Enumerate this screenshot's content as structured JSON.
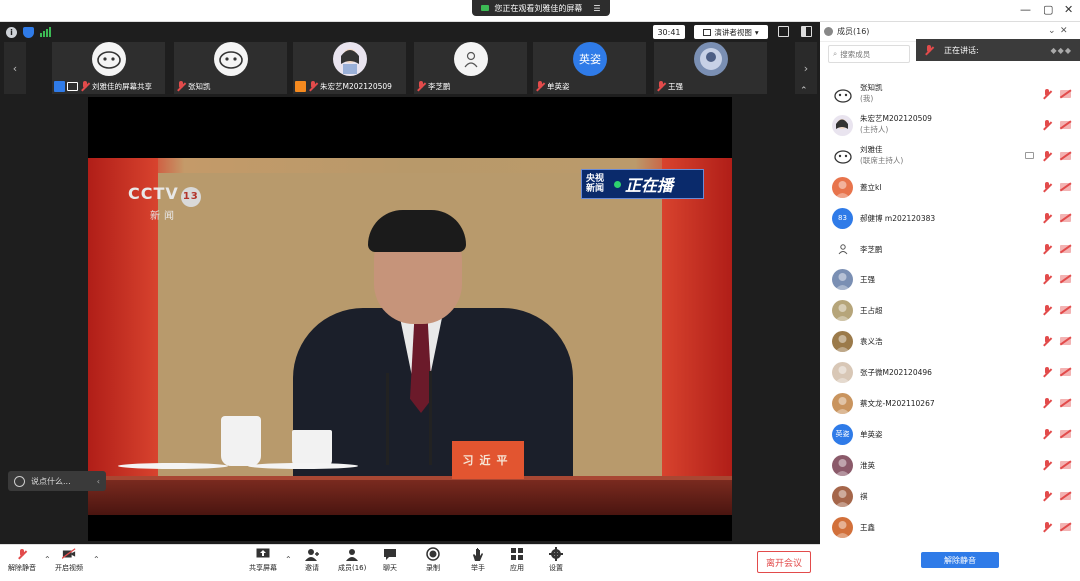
{
  "window": {
    "share_banner": "您正在观看刘雅佳的屏幕",
    "controls": [
      "—",
      "▢",
      "✕"
    ]
  },
  "meeting": {
    "timer": "30:41",
    "view_mode": "演讲者视图",
    "thumbnails": [
      {
        "name": "刘雅佳的屏幕共享"
      },
      {
        "name": "张知凯"
      },
      {
        "name": "朱宏艺M202120509"
      },
      {
        "name": "李芝鹏"
      },
      {
        "name": "单英姿",
        "avatar_text": "英姿",
        "avatar_color": "#2f7be8"
      },
      {
        "name": "王强"
      }
    ],
    "comment_placeholder": "说点什么..."
  },
  "video": {
    "channel_logo": "CCTV",
    "channel_num": "13",
    "channel_sub": "新闻",
    "live_tag_a": "央视新闻",
    "live_tag_b": "正在播",
    "nameplate": "习近平"
  },
  "toolbar": {
    "unmute": "解除静音",
    "start_video": "开启视频",
    "share_screen": "共享屏幕",
    "invite": "邀请",
    "members": "成员(16)",
    "chat": "聊天",
    "record": "录制",
    "raise_hand": "举手",
    "apps": "应用",
    "settings": "设置",
    "leave": "离开会议"
  },
  "panel": {
    "title": "成员(16)",
    "search_placeholder": "搜索成员",
    "speaking_label": "正在讲话:",
    "unmute_all": "解除静音",
    "members": [
      {
        "name": "张知凯",
        "role": "(我)",
        "avatar": "cartoon"
      },
      {
        "name": "朱宏艺M202120509",
        "role": "(主持人)",
        "avatar": "anime"
      },
      {
        "name": "刘雅佳",
        "role": "(联席主持人)",
        "avatar": "cartoon",
        "sharing": true
      },
      {
        "name": "蓋立kl",
        "role": "",
        "avatar": "photo",
        "color": "#e8744c"
      },
      {
        "name": "郝健博 m202120383",
        "role": "",
        "avatar_text": "83",
        "color": "#2f7be8"
      },
      {
        "name": "李芝鹏",
        "role": "",
        "avatar": "small"
      },
      {
        "name": "王强",
        "role": "",
        "avatar": "photo",
        "color": "#7a8fb3"
      },
      {
        "name": "王占超",
        "role": "",
        "avatar": "photo",
        "color": "#b6a57a"
      },
      {
        "name": "袁义浩",
        "role": "",
        "avatar": "photo",
        "color": "#9b7a4a"
      },
      {
        "name": "张子微M202120496",
        "role": "",
        "avatar": "photo",
        "color": "#d8c7b6"
      },
      {
        "name": "蔡文龙-M202110267",
        "role": "",
        "avatar": "photo",
        "color": "#c9945e"
      },
      {
        "name": "单英姿",
        "role": "",
        "avatar_text": "英姿",
        "color": "#2f7be8"
      },
      {
        "name": "淮英",
        "role": "",
        "avatar": "photo",
        "color": "#8b5a6a"
      },
      {
        "name": "祺",
        "role": "",
        "avatar": "photo",
        "color": "#a5664a"
      },
      {
        "name": "王鑫",
        "role": "",
        "avatar": "photo",
        "color": "#d2703a"
      }
    ]
  }
}
